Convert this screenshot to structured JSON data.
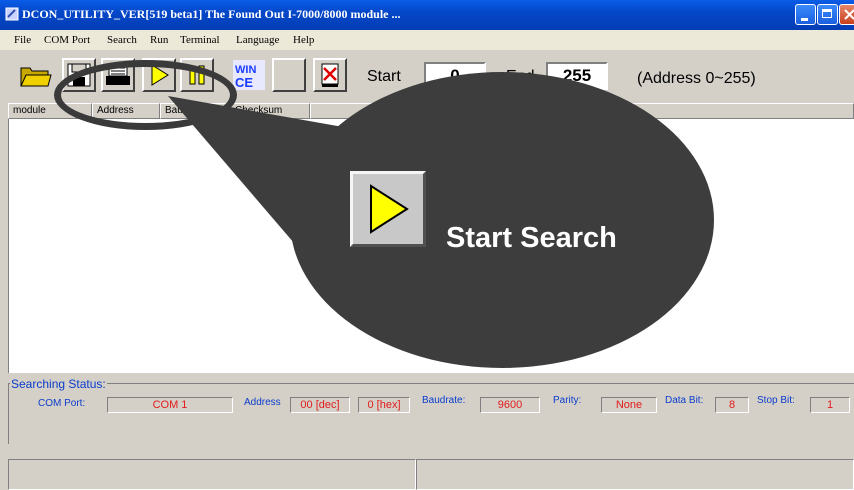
{
  "window": {
    "title": "DCON_UTILITY_VER[519  beta1] The Found Out I-7000/8000 module ..."
  },
  "menu": {
    "items": [
      "File",
      "COM Port",
      "Search",
      "Run",
      "Terminal",
      "Language",
      "Help"
    ]
  },
  "toolbar": {
    "icons": [
      "open-folder-icon",
      "save-icon",
      "print-icon",
      "start-search-icon",
      "pause-icon",
      "wince-icon",
      "blank-button",
      "stop-icon"
    ],
    "start_label": "Start",
    "start_value": "0",
    "end_label": "End",
    "end_value": "255",
    "range_hint": "(Address 0~255)"
  },
  "list": {
    "columns": [
      "module",
      "Address",
      "Baudrate:",
      "Checksum"
    ]
  },
  "callout": {
    "text": "Start Search",
    "colors": {
      "bubble": "#3d3d3d",
      "text": "#ffffff",
      "play": "#ffff00"
    }
  },
  "status": {
    "legend": "Searching Status:",
    "com_port_label": "COM Port:",
    "com_port_value": "COM 1",
    "address_label": "Address",
    "address_dec": "00 [dec]",
    "address_hex": "0 [hex]",
    "baudrate_label": "Baudrate:",
    "baudrate_value": "9600",
    "parity_label": "Parity:",
    "parity_value": "None",
    "databit_label": "Data Bit:",
    "databit_value": "8",
    "stopbit_label": "Stop Bit:",
    "stopbit_value": "1"
  }
}
